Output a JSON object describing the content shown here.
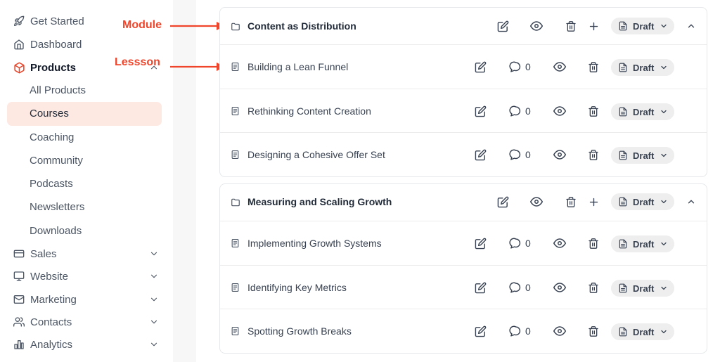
{
  "sidebar": {
    "items": [
      {
        "label": "Get Started",
        "icon": "rocket-icon"
      },
      {
        "label": "Dashboard",
        "icon": "home-icon"
      },
      {
        "label": "Products",
        "icon": "box-icon"
      }
    ],
    "products_sub": [
      "All Products",
      "Courses",
      "Coaching",
      "Community",
      "Podcasts",
      "Newsletters",
      "Downloads"
    ],
    "sections": [
      {
        "label": "Sales",
        "icon": "credit-card-icon"
      },
      {
        "label": "Website",
        "icon": "monitor-icon"
      },
      {
        "label": "Marketing",
        "icon": "mail-icon"
      },
      {
        "label": "Contacts",
        "icon": "users-icon"
      },
      {
        "label": "Analytics",
        "icon": "bar-chart-icon"
      }
    ]
  },
  "annotations": {
    "module": "Module",
    "lesson": "Lessson"
  },
  "colors": {
    "accent": "#e8462a",
    "annotation": "#f0452b",
    "selected_bg": "#fde8e2"
  },
  "modules": [
    {
      "title": "Content as Distribution",
      "status": "Draft",
      "lessons": [
        {
          "title": "Building a Lean Funnel",
          "comments": "0",
          "status": "Draft"
        },
        {
          "title": "Rethinking Content Creation",
          "comments": "0",
          "status": "Draft"
        },
        {
          "title": "Designing a Cohesive Offer Set",
          "comments": "0",
          "status": "Draft"
        }
      ]
    },
    {
      "title": "Measuring and Scaling Growth",
      "status": "Draft",
      "lessons": [
        {
          "title": "Implementing Growth Systems",
          "comments": "0",
          "status": "Draft"
        },
        {
          "title": "Identifying Key Metrics",
          "comments": "0",
          "status": "Draft"
        },
        {
          "title": "Spotting Growth Breaks",
          "comments": "0",
          "status": "Draft"
        }
      ]
    }
  ]
}
